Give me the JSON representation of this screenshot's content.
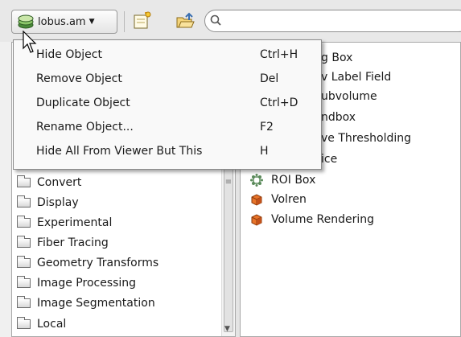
{
  "toolbar": {
    "object_button_label": "lobus.am",
    "search_value": ""
  },
  "menu": {
    "items": [
      {
        "label": "Hide Object",
        "shortcut": "Ctrl+H"
      },
      {
        "label": "Remove Object",
        "shortcut": "Del"
      },
      {
        "label": "Duplicate Object",
        "shortcut": "Ctrl+D"
      },
      {
        "label": "Rename Object...",
        "shortcut": "F2"
      },
      {
        "label": "Hide All From Viewer But This",
        "shortcut": "H"
      }
    ]
  },
  "left_panel": {
    "folders": [
      {
        "label": "Convert"
      },
      {
        "label": "Display"
      },
      {
        "label": "Experimental"
      },
      {
        "label": "Fiber Tracing"
      },
      {
        "label": "Geometry Transforms"
      },
      {
        "label": "Image Processing"
      },
      {
        "label": "Image Segmentation"
      },
      {
        "label": "Local"
      }
    ]
  },
  "right_panel": {
    "partial_items": [
      {
        "text": "g Box"
      },
      {
        "text": "v Label Field"
      },
      {
        "text": "ubvolume"
      },
      {
        "text": "ndbox"
      },
      {
        "text": "ve Thresholding"
      },
      {
        "text": "ice"
      }
    ],
    "items": [
      {
        "label": "ROI Box",
        "icon": "roi-box-icon"
      },
      {
        "label": "Volren",
        "icon": "volume-cube-icon"
      },
      {
        "label": "Volume Rendering",
        "icon": "volume-cube-icon"
      }
    ]
  },
  "colors": {
    "cube_orange": "#e8742a",
    "roi_green": "#5a8a5a"
  }
}
